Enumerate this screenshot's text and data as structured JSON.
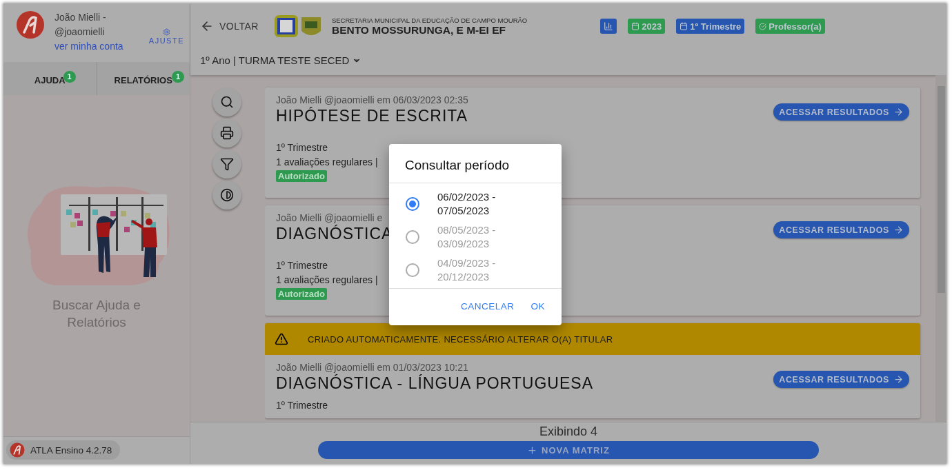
{
  "user": {
    "name": "João Mielli -",
    "handle": "@joaomielli",
    "account_link": "ver minha conta",
    "settings": "AJUSTE"
  },
  "sidebar_tabs": [
    {
      "label": "AJUDA",
      "badge": "1"
    },
    {
      "label": "RELATÓRIOS",
      "badge": "1"
    }
  ],
  "sidebar_empty": {
    "message": "Buscar Ajuda e Relatórios"
  },
  "version": "ATLA Ensino 4.2.78",
  "header": {
    "back": "VOLTAR",
    "org": "SECRETARIA MUNICIPAL DA EDUCAÇÃO DE CAMPO MOURÃO",
    "school": "BENTO MOSSURUNGA, E M-EI EF",
    "chips": [
      {
        "kind": "chart",
        "color": "#2756b0"
      },
      {
        "kind": "calendar",
        "label": "2023",
        "color": "#2e9a4f"
      },
      {
        "kind": "calendar",
        "label": "1º Trimestre",
        "color": "#2756b0"
      },
      {
        "kind": "check",
        "label": "Professor(a)",
        "color": "#2e9a4f"
      }
    ]
  },
  "class_selector": "1º Ano | TURMA TESTE SECED",
  "cards": [
    {
      "meta": "João Mielli @joaomielli em 06/03/2023 02:35",
      "title": "HIPÓTESE DE ESCRITA",
      "period": "1º Trimestre",
      "evaluations": "1 avaliações regulares |",
      "status": "Autorizado",
      "action": "ACESSAR RESULTADOS"
    },
    {
      "meta": "João Mielli @joaomielli e",
      "title": "DIAGNÓSTICA",
      "period": "1º Trimestre",
      "evaluations": "1 avaliações regulares |",
      "status": "Autorizado",
      "action": "ACESSAR RESULTADOS"
    },
    {
      "warning": "CRIADO AUTOMATICAMENTE. NECESSÁRIO ALTERAR O(A) TITULAR",
      "meta": "João Mielli @joaomielli em 01/03/2023 10:21",
      "title": "DIAGNÓSTICA - LÍNGUA PORTUGUESA",
      "period": "1º Trimestre",
      "action": "ACESSAR RESULTADOS"
    }
  ],
  "footer": {
    "count": "Exibindo 4",
    "new_button": "NOVA MATRIZ"
  },
  "dialog": {
    "title": "Consultar período",
    "options": [
      {
        "label": "06/02/2023 - 07/05/2023",
        "selected": true
      },
      {
        "label": "08/05/2023 - 03/09/2023",
        "selected": false
      },
      {
        "label": "04/09/2023 - 20/12/2023",
        "selected": false
      }
    ],
    "buttons": [
      "CANCELAR",
      "OK"
    ]
  }
}
